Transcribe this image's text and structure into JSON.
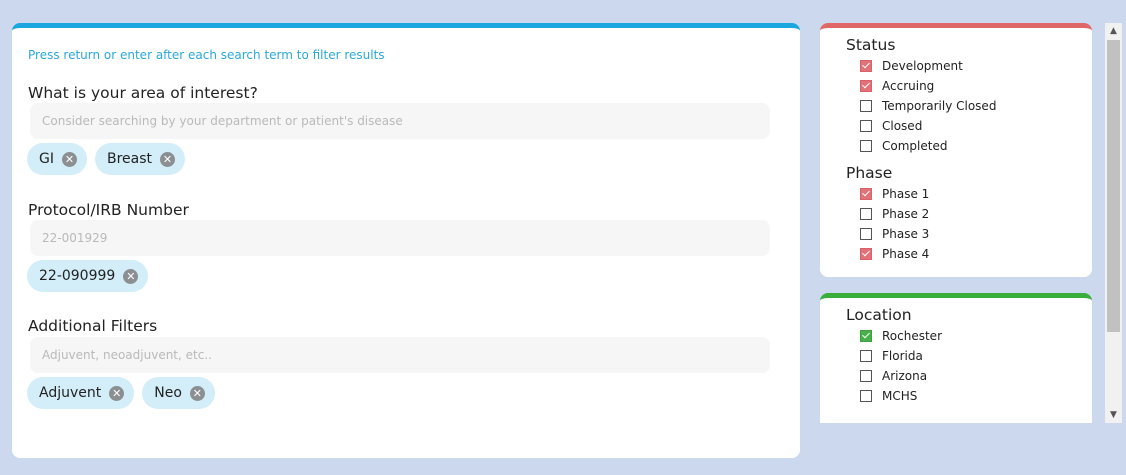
{
  "filters": {
    "hint": "Press return or enter after each search term to filter results",
    "interest": {
      "title": "What is your area of interest?",
      "placeholder": "Consider searching by your department or patient's disease",
      "chips": [
        "GI",
        "Breast"
      ]
    },
    "protocol": {
      "title": "Protocol/IRB Number",
      "placeholder": "22-001929",
      "chips": [
        "22-090999"
      ]
    },
    "additional": {
      "title": "Additional Filters",
      "placeholder": "Adjuvent, neoadjuvent, etc..",
      "chips": [
        "Adjuvent",
        "Neo"
      ]
    }
  },
  "status": {
    "title": "Status",
    "options": [
      {
        "label": "Development",
        "checked": true
      },
      {
        "label": "Accruing",
        "checked": true
      },
      {
        "label": "Temporarily Closed",
        "checked": false
      },
      {
        "label": "Closed",
        "checked": false
      },
      {
        "label": "Completed",
        "checked": false
      }
    ]
  },
  "phase": {
    "title": "Phase",
    "options": [
      {
        "label": "Phase 1",
        "checked": true
      },
      {
        "label": "Phase 2",
        "checked": false
      },
      {
        "label": "Phase 3",
        "checked": false
      },
      {
        "label": "Phase 4",
        "checked": true
      }
    ]
  },
  "location": {
    "title": "Location",
    "options": [
      {
        "label": "Rochester",
        "checked": true
      },
      {
        "label": "Florida",
        "checked": false
      },
      {
        "label": "Arizona",
        "checked": false
      },
      {
        "label": "MCHS",
        "checked": false
      }
    ]
  },
  "colors": {
    "search_accent": "#1aa7df",
    "status_accent": "#e06767",
    "location_accent": "#3aae3a",
    "chip_background": "#d3eef9",
    "page_background": "#ccd8ee"
  },
  "icons": {
    "chip_remove": "close-circle-icon",
    "checkbox_checked": "checkmark-icon",
    "scroll_up": "chevron-up-icon",
    "scroll_down": "chevron-down-icon"
  }
}
